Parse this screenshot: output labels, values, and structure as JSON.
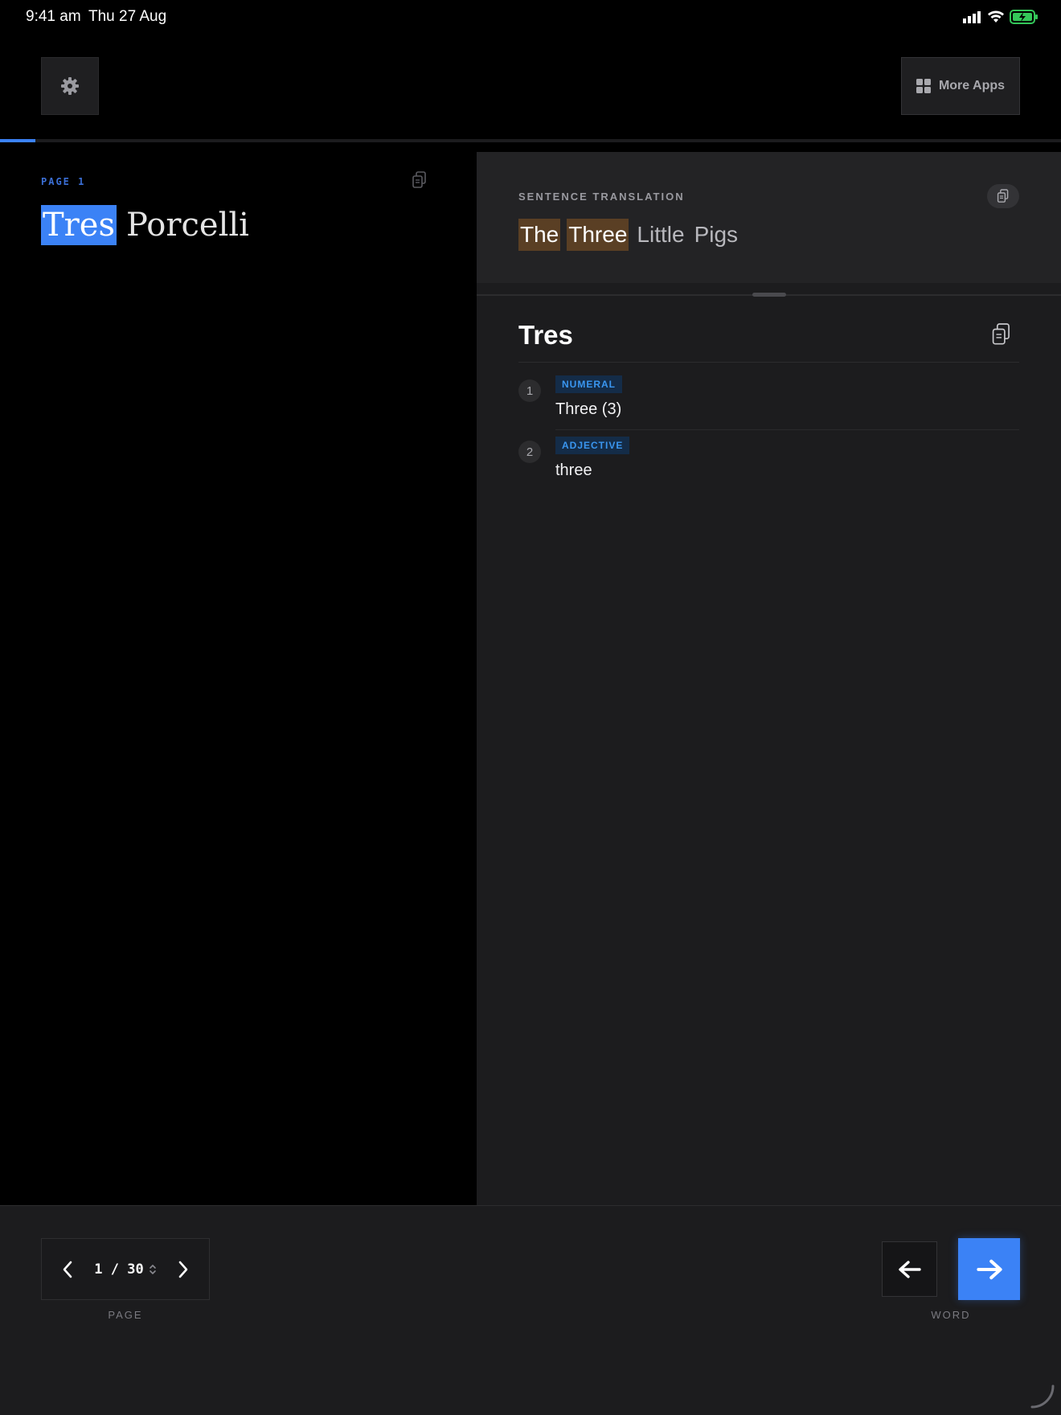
{
  "status_bar": {
    "time": "9:41 am",
    "date": "Thu 27 Aug",
    "icons": [
      "cellular-signal-icon",
      "wifi-icon",
      "battery-charging-icon"
    ]
  },
  "toolbar": {
    "settings_icon": "gear-icon",
    "more_apps_label": "More Apps",
    "more_apps_icon": "grid-icon"
  },
  "progress": {
    "fraction": 0.033,
    "color": "#3b82f6"
  },
  "source": {
    "page_label": "PAGE 1",
    "words": [
      {
        "text": "Tres",
        "active": true
      },
      {
        "text": "Porcelli",
        "active": false
      }
    ]
  },
  "translation": {
    "label": "SENTENCE TRANSLATION",
    "words": [
      {
        "text": "The",
        "highlighted": true
      },
      {
        "text": "Three",
        "highlighted": true
      },
      {
        "text": "Little",
        "highlighted": false
      },
      {
        "text": "Pigs",
        "highlighted": false
      }
    ]
  },
  "dictionary": {
    "word": "Tres",
    "definitions": [
      {
        "number": "1",
        "pos": "NUMERAL",
        "meaning": "Three (3)"
      },
      {
        "number": "2",
        "pos": "ADJECTIVE",
        "meaning": "three"
      }
    ]
  },
  "bottom": {
    "page_display": "1 / 30",
    "page_caption": "PAGE",
    "word_caption": "WORD"
  },
  "colors": {
    "accent": "#3b82f6",
    "word_highlight": "#5a3f24",
    "pos_tag_bg": "#142c48",
    "pos_tag_text": "#3a96f0"
  }
}
